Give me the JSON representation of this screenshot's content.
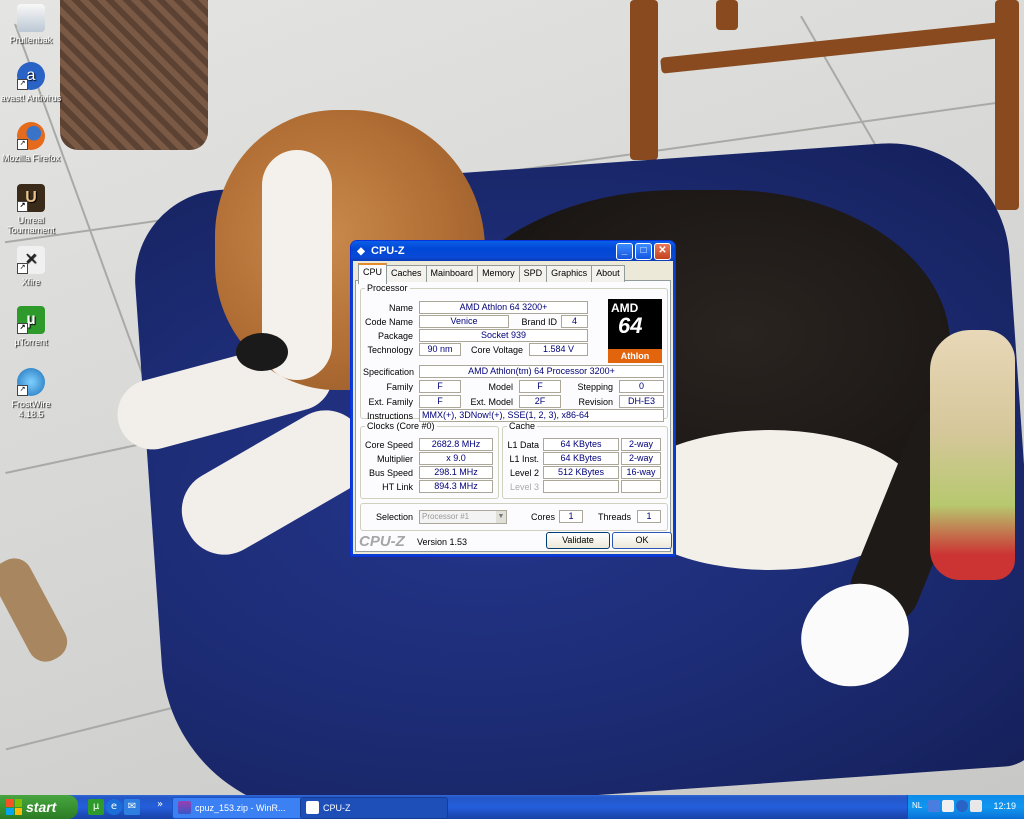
{
  "desktop": {
    "icons": [
      {
        "label": "Prullenbak",
        "icon": "recycle-bin-icon"
      },
      {
        "label": "avast! Antivirus",
        "icon": "avast-icon"
      },
      {
        "label": "Mozilla Firefox",
        "icon": "firefox-icon"
      },
      {
        "label": "Unreal Tournament",
        "icon": "unreal-tournament-icon"
      },
      {
        "label": "Xfire",
        "icon": "xfire-icon"
      },
      {
        "label": "µTorrent",
        "icon": "utorrent-icon"
      },
      {
        "label": "FrostWire 4.18.5",
        "icon": "frostwire-icon"
      }
    ]
  },
  "window": {
    "title": "CPU-Z",
    "controls": {
      "minimize": "_",
      "maximize": "□",
      "close": "✕"
    },
    "tabs": [
      "CPU",
      "Caches",
      "Mainboard",
      "Memory",
      "SPD",
      "Graphics",
      "About"
    ],
    "active_tab": "CPU",
    "processor": {
      "legend": "Processor",
      "name_label": "Name",
      "name": "AMD Athlon 64 3200+",
      "codename_label": "Code Name",
      "codename": "Venice",
      "brandid_label": "Brand ID",
      "brandid": "4",
      "package_label": "Package",
      "package": "Socket 939",
      "technology_label": "Technology",
      "technology": "90 nm",
      "voltage_label": "Core Voltage",
      "voltage": "1.584 V",
      "spec_label": "Specification",
      "spec": "AMD Athlon(tm) 64 Processor 3200+",
      "family_label": "Family",
      "family": "F",
      "model_label": "Model",
      "model": "F",
      "stepping_label": "Stepping",
      "stepping": "0",
      "extfamily_label": "Ext. Family",
      "extfamily": "F",
      "extmodel_label": "Ext. Model",
      "extmodel": "2F",
      "revision_label": "Revision",
      "revision": "DH-E3",
      "instructions_label": "Instructions",
      "instructions": "MMX(+), 3DNow!(+), SSE(1, 2, 3), x86-64",
      "logo": {
        "brand": "AMD",
        "number": "64",
        "product": "Athlon"
      }
    },
    "clocks": {
      "legend": "Clocks (Core #0)",
      "core_speed_label": "Core Speed",
      "core_speed": "2682.8 MHz",
      "multiplier_label": "Multiplier",
      "multiplier": "x 9.0",
      "bus_speed_label": "Bus Speed",
      "bus_speed": "298.1 MHz",
      "ht_link_label": "HT Link",
      "ht_link": "894.3 MHz"
    },
    "cache": {
      "legend": "Cache",
      "l1data_label": "L1 Data",
      "l1data": "64 KBytes",
      "l1data_way": "2-way",
      "l1inst_label": "L1 Inst.",
      "l1inst": "64 KBytes",
      "l1inst_way": "2-way",
      "l2_label": "Level 2",
      "l2": "512 KBytes",
      "l2_way": "16-way",
      "l3_label": "Level 3"
    },
    "selection": {
      "label": "Selection",
      "value": "Processor #1",
      "cores_label": "Cores",
      "cores": "1",
      "threads_label": "Threads",
      "threads": "1"
    },
    "footer": {
      "brand": "CPU-Z",
      "version": "Version 1.53",
      "validate": "Validate",
      "ok": "OK"
    }
  },
  "taskbar": {
    "start": "start",
    "quicklaunch": [
      "utorrent-icon",
      "ie-icon",
      "outlook-express-icon"
    ],
    "overflow": "»",
    "tasks": [
      {
        "label": "cpuz_153.zip - WinR...",
        "icon": "winrar-icon"
      },
      {
        "label": "CPU-Z",
        "icon": "cpuz-icon"
      }
    ],
    "tray": {
      "lang": "NL",
      "clock": "12:19"
    }
  },
  "colors": {
    "xp_blue": "#0a4ad8",
    "start_green": "#389330",
    "tab_accent": "#e68b2c",
    "value_text": "#00007a"
  }
}
